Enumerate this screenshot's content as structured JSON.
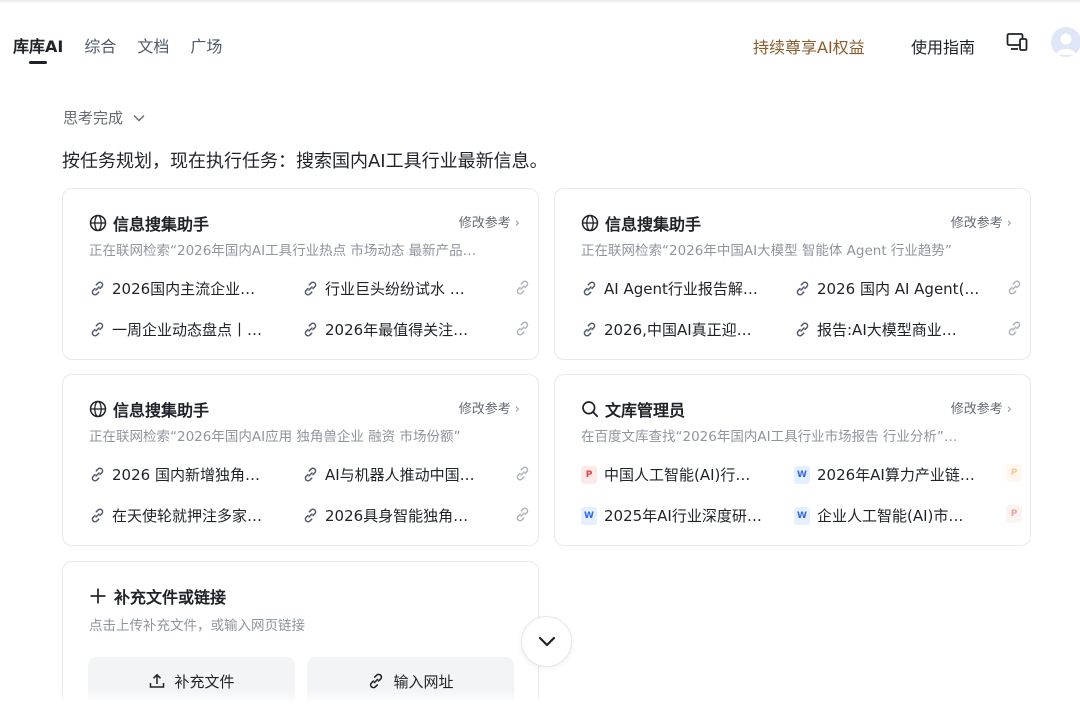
{
  "header": {
    "nav": [
      "库库AI",
      "综合",
      "文档",
      "广场"
    ],
    "promo": "持续尊享AI权益",
    "guide": "使用指南"
  },
  "thinking": {
    "label": "思考完成"
  },
  "task_text": "按任务规划，现在执行任务：搜索国内AI工具行业最新信息。",
  "cards": [
    {
      "title": "信息搜集助手",
      "edit": "修改参考",
      "subtitle": "正在联网检索“2026年国内AI工具行业热点 市场动态 最新产品…",
      "refs": [
        "2026国内主流企业…",
        "行业巨头纷纷试水 …",
        "一周企业动态盘点丨…",
        "2026年最值得关注…"
      ]
    },
    {
      "title": "信息搜集助手",
      "edit": "修改参考",
      "subtitle": "正在联网检索“2026年中国AI大模型 智能体 Agent 行业趋势”",
      "refs": [
        "AI Agent行业报告解…",
        "2026 国内 AI Agent(…",
        "2026,中国AI真正迎…",
        "报告:AI大模型商业…"
      ]
    },
    {
      "title": "信息搜集助手",
      "edit": "修改参考",
      "subtitle": "正在联网检索“2026年国内AI应用 独角兽企业 融资 市场份额”",
      "refs": [
        "2026 国内新增独角…",
        "AI与机器人推动中国…",
        "在天使轮就押注多家…",
        "2026具身智能独角…"
      ]
    },
    {
      "title": "文库管理员",
      "edit": "修改参考",
      "subtitle": "在百度文库查找“2026年国内AI工具行业市场报告 行业分析”…",
      "refs": [
        "中国人工智能(AI)行…",
        "2026年AI算力产业链…",
        "2025年AI行业深度研…",
        "企业人工智能(AI)市…"
      ]
    }
  ],
  "supplement": {
    "title": "补充文件或链接",
    "subtitle": "点击上传补充文件，或输入网页链接",
    "upload_label": "补充文件",
    "url_label": "输入网址"
  },
  "icons": {
    "doc_pdf": "P",
    "doc_word": "W",
    "doc_ppt": "P"
  },
  "colors": {
    "promo": "#8a5a2b",
    "pdf": "#e8413b",
    "word": "#2f6ae5",
    "ppt": "#f28c2e"
  }
}
